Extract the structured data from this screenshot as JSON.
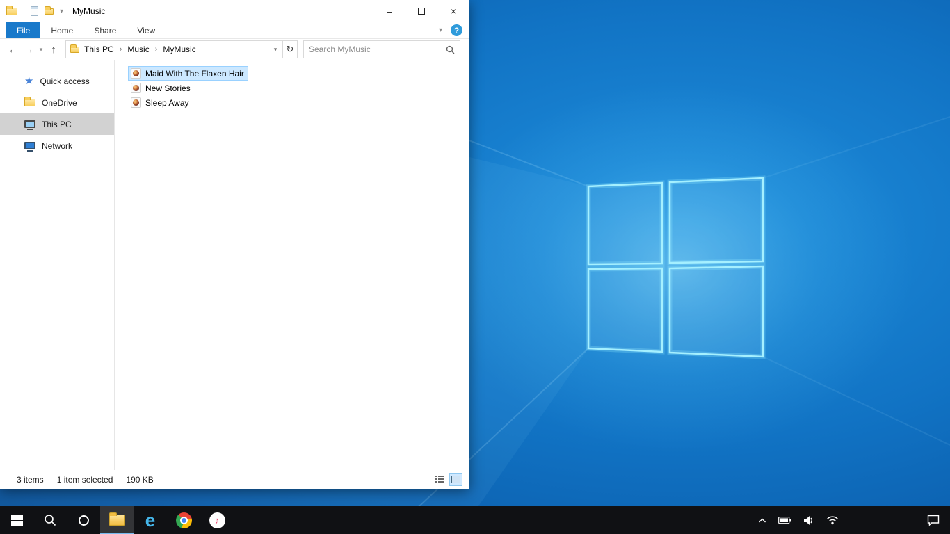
{
  "colors": {
    "accent_blue": "#1979ca",
    "selection_bg": "#cce8ff",
    "selection_border": "#99d1ff",
    "sidebar_selected": "#d2d2d2",
    "taskbar_bg": "#101114",
    "wallpaper_base": "#0f6fc0",
    "logo_edge": "#8feaff"
  },
  "titlebar": {
    "title": "MyMusic"
  },
  "ribbon": {
    "tabs": [
      {
        "label": "File"
      },
      {
        "label": "Home"
      },
      {
        "label": "Share"
      },
      {
        "label": "View"
      }
    ]
  },
  "navbar": {
    "breadcrumb": [
      "This PC",
      "Music",
      "MyMusic"
    ],
    "search_placeholder": "Search MyMusic"
  },
  "sidebar": {
    "items": [
      {
        "label": "Quick access"
      },
      {
        "label": "OneDrive"
      },
      {
        "label": "This PC"
      },
      {
        "label": "Network"
      }
    ]
  },
  "files": [
    {
      "name": "Maid With The Flaxen Hair",
      "selected": true
    },
    {
      "name": "New Stories",
      "selected": false
    },
    {
      "name": "Sleep Away",
      "selected": false
    }
  ],
  "statusbar": {
    "items_count": "3 items",
    "selection_count": "1 item selected",
    "selection_size": "190 KB"
  },
  "glyphs": {
    "back_arrow": "←",
    "forward_arrow": "→",
    "dropdown_chevron": "▾",
    "up_arrow": "↑",
    "refresh": "↻",
    "crumb_separator": "›",
    "ribbon_collapse": "▾",
    "help": "?",
    "minimize": "–",
    "close": "×",
    "quick_access_star": "★",
    "ie_letter": "e",
    "music_note": "♪"
  }
}
